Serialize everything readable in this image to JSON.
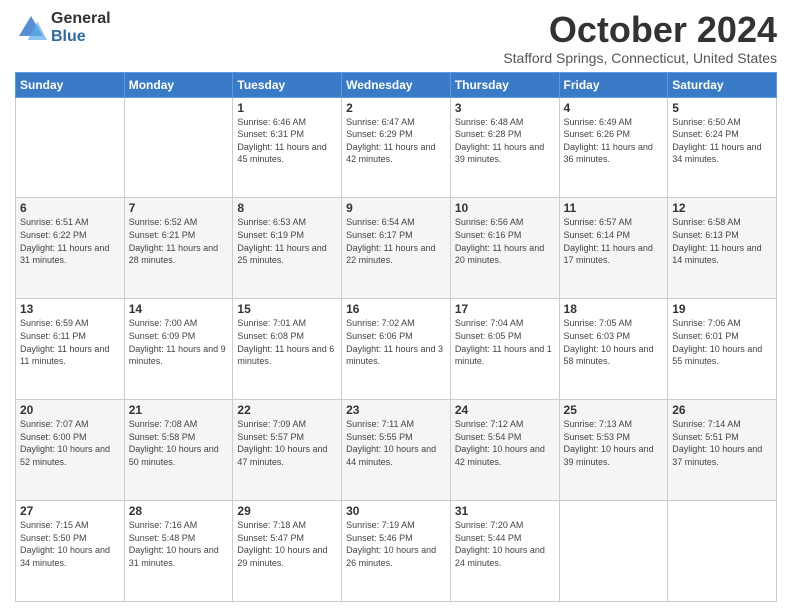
{
  "logo": {
    "general": "General",
    "blue": "Blue"
  },
  "title": "October 2024",
  "location": "Stafford Springs, Connecticut, United States",
  "days_of_week": [
    "Sunday",
    "Monday",
    "Tuesday",
    "Wednesday",
    "Thursday",
    "Friday",
    "Saturday"
  ],
  "weeks": [
    [
      {
        "day": "",
        "info": ""
      },
      {
        "day": "",
        "info": ""
      },
      {
        "day": "1",
        "info": "Sunrise: 6:46 AM\nSunset: 6:31 PM\nDaylight: 11 hours and 45 minutes."
      },
      {
        "day": "2",
        "info": "Sunrise: 6:47 AM\nSunset: 6:29 PM\nDaylight: 11 hours and 42 minutes."
      },
      {
        "day": "3",
        "info": "Sunrise: 6:48 AM\nSunset: 6:28 PM\nDaylight: 11 hours and 39 minutes."
      },
      {
        "day": "4",
        "info": "Sunrise: 6:49 AM\nSunset: 6:26 PM\nDaylight: 11 hours and 36 minutes."
      },
      {
        "day": "5",
        "info": "Sunrise: 6:50 AM\nSunset: 6:24 PM\nDaylight: 11 hours and 34 minutes."
      }
    ],
    [
      {
        "day": "6",
        "info": "Sunrise: 6:51 AM\nSunset: 6:22 PM\nDaylight: 11 hours and 31 minutes."
      },
      {
        "day": "7",
        "info": "Sunrise: 6:52 AM\nSunset: 6:21 PM\nDaylight: 11 hours and 28 minutes."
      },
      {
        "day": "8",
        "info": "Sunrise: 6:53 AM\nSunset: 6:19 PM\nDaylight: 11 hours and 25 minutes."
      },
      {
        "day": "9",
        "info": "Sunrise: 6:54 AM\nSunset: 6:17 PM\nDaylight: 11 hours and 22 minutes."
      },
      {
        "day": "10",
        "info": "Sunrise: 6:56 AM\nSunset: 6:16 PM\nDaylight: 11 hours and 20 minutes."
      },
      {
        "day": "11",
        "info": "Sunrise: 6:57 AM\nSunset: 6:14 PM\nDaylight: 11 hours and 17 minutes."
      },
      {
        "day": "12",
        "info": "Sunrise: 6:58 AM\nSunset: 6:13 PM\nDaylight: 11 hours and 14 minutes."
      }
    ],
    [
      {
        "day": "13",
        "info": "Sunrise: 6:59 AM\nSunset: 6:11 PM\nDaylight: 11 hours and 11 minutes."
      },
      {
        "day": "14",
        "info": "Sunrise: 7:00 AM\nSunset: 6:09 PM\nDaylight: 11 hours and 9 minutes."
      },
      {
        "day": "15",
        "info": "Sunrise: 7:01 AM\nSunset: 6:08 PM\nDaylight: 11 hours and 6 minutes."
      },
      {
        "day": "16",
        "info": "Sunrise: 7:02 AM\nSunset: 6:06 PM\nDaylight: 11 hours and 3 minutes."
      },
      {
        "day": "17",
        "info": "Sunrise: 7:04 AM\nSunset: 6:05 PM\nDaylight: 11 hours and 1 minute."
      },
      {
        "day": "18",
        "info": "Sunrise: 7:05 AM\nSunset: 6:03 PM\nDaylight: 10 hours and 58 minutes."
      },
      {
        "day": "19",
        "info": "Sunrise: 7:06 AM\nSunset: 6:01 PM\nDaylight: 10 hours and 55 minutes."
      }
    ],
    [
      {
        "day": "20",
        "info": "Sunrise: 7:07 AM\nSunset: 6:00 PM\nDaylight: 10 hours and 52 minutes."
      },
      {
        "day": "21",
        "info": "Sunrise: 7:08 AM\nSunset: 5:58 PM\nDaylight: 10 hours and 50 minutes."
      },
      {
        "day": "22",
        "info": "Sunrise: 7:09 AM\nSunset: 5:57 PM\nDaylight: 10 hours and 47 minutes."
      },
      {
        "day": "23",
        "info": "Sunrise: 7:11 AM\nSunset: 5:55 PM\nDaylight: 10 hours and 44 minutes."
      },
      {
        "day": "24",
        "info": "Sunrise: 7:12 AM\nSunset: 5:54 PM\nDaylight: 10 hours and 42 minutes."
      },
      {
        "day": "25",
        "info": "Sunrise: 7:13 AM\nSunset: 5:53 PM\nDaylight: 10 hours and 39 minutes."
      },
      {
        "day": "26",
        "info": "Sunrise: 7:14 AM\nSunset: 5:51 PM\nDaylight: 10 hours and 37 minutes."
      }
    ],
    [
      {
        "day": "27",
        "info": "Sunrise: 7:15 AM\nSunset: 5:50 PM\nDaylight: 10 hours and 34 minutes."
      },
      {
        "day": "28",
        "info": "Sunrise: 7:16 AM\nSunset: 5:48 PM\nDaylight: 10 hours and 31 minutes."
      },
      {
        "day": "29",
        "info": "Sunrise: 7:18 AM\nSunset: 5:47 PM\nDaylight: 10 hours and 29 minutes."
      },
      {
        "day": "30",
        "info": "Sunrise: 7:19 AM\nSunset: 5:46 PM\nDaylight: 10 hours and 26 minutes."
      },
      {
        "day": "31",
        "info": "Sunrise: 7:20 AM\nSunset: 5:44 PM\nDaylight: 10 hours and 24 minutes."
      },
      {
        "day": "",
        "info": ""
      },
      {
        "day": "",
        "info": ""
      }
    ]
  ]
}
